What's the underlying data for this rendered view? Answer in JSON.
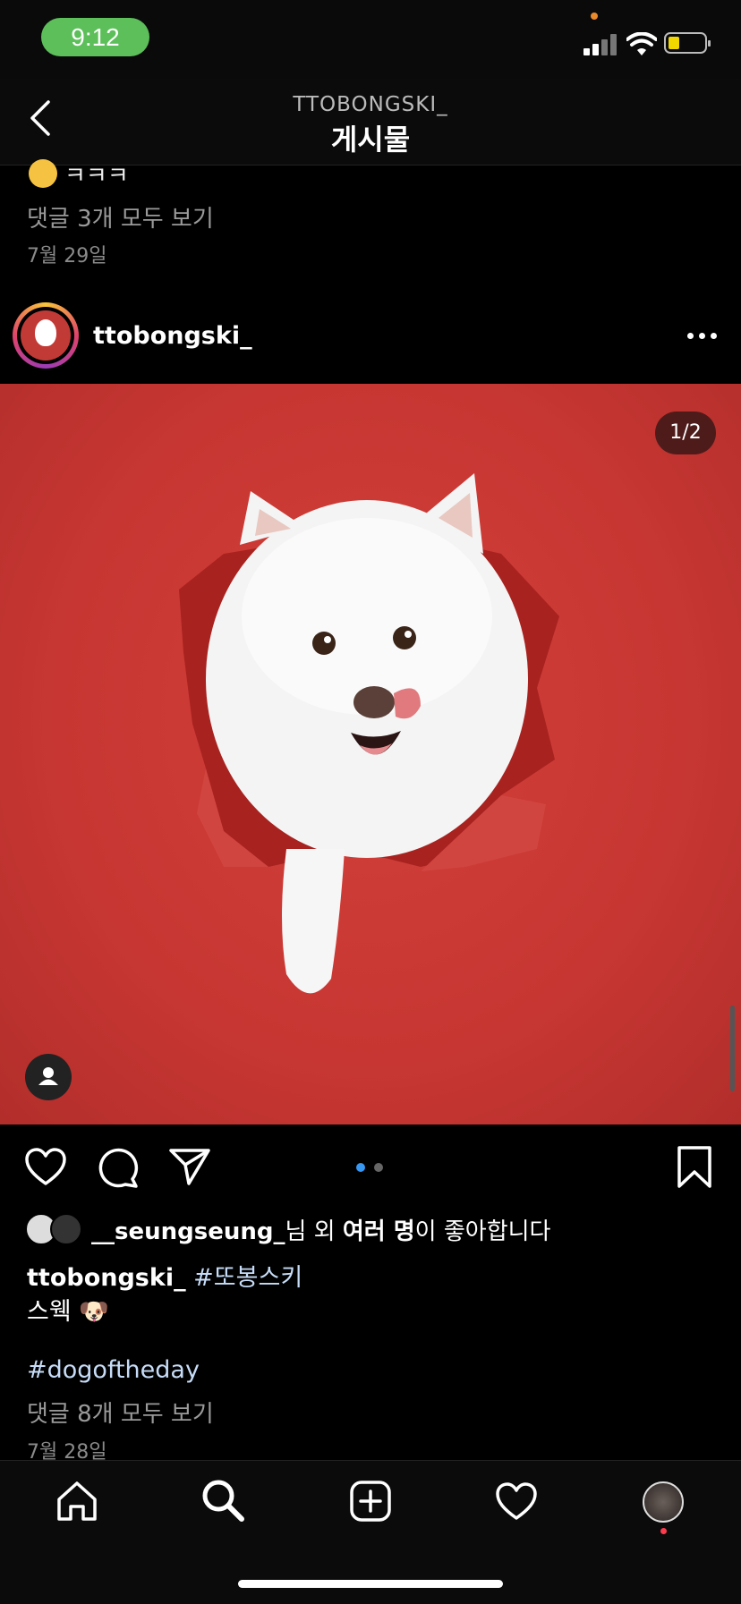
{
  "status_bar": {
    "time": "9:12",
    "colors": {
      "time_pill": "#5cbf5a",
      "battery_fill": "#f1d600"
    }
  },
  "header": {
    "username": "TTOBONGSKI_",
    "title": "게시물"
  },
  "previous_post": {
    "comment_text": "ㅋㅋㅋ",
    "view_comments": "댓글 3개 모두 보기",
    "date": "7월 29일"
  },
  "post": {
    "username": "ttobongski_",
    "image_counter": "1/2",
    "carousel_dots": {
      "total": 2,
      "active": 1,
      "active_color": "#3897f0"
    },
    "likes": {
      "user": "__seungseung_",
      "text_1": "님 외 ",
      "bold": "여러 명",
      "text_2": "이 좋아합니다"
    },
    "caption": {
      "username": "ttobongski_",
      "hashtag": "#또봉스키",
      "line2": "스웩 🐶",
      "hashtag2": "#dogoftheday"
    },
    "view_comments": "댓글 8개 모두 보기",
    "date": "7월 28일"
  },
  "icons": [
    "back-icon",
    "more-icon",
    "user-tag-icon",
    "heart-icon",
    "comment-icon",
    "share-icon",
    "bookmark-icon",
    "home-icon",
    "search-icon",
    "add-icon",
    "activity-icon",
    "profile-icon"
  ]
}
